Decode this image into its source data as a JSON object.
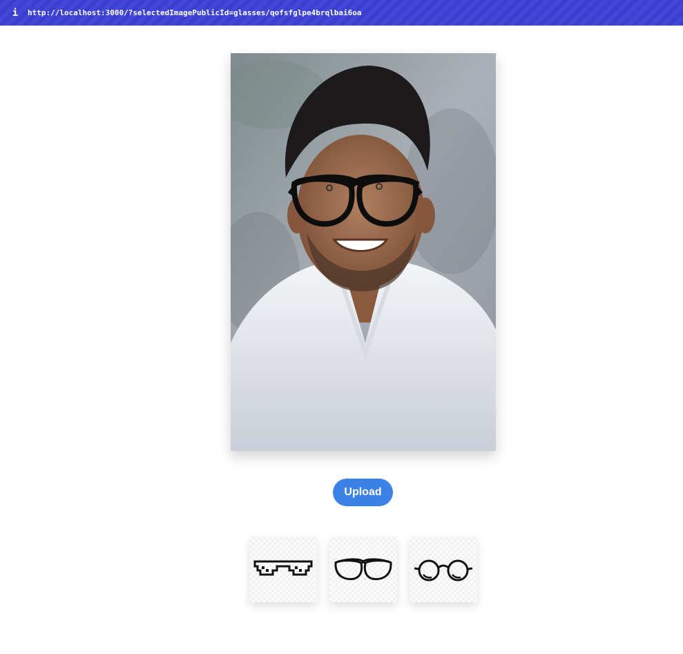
{
  "url_bar": {
    "info_icon": "info-icon",
    "url": "http://localhost:3000/?selectedImagePublicId=glasses/qofsfglpe4brqlbai6oa",
    "background_color": "#3b3fd0"
  },
  "main": {
    "photo": {
      "icon": "portrait-photo-with-glasses-overlay"
    },
    "upload_button": {
      "label": "Upload",
      "color": "#3b82e6"
    },
    "glasses_options": [
      {
        "icon": "pixel-sunglasses-icon"
      },
      {
        "icon": "aviator-glasses-icon"
      },
      {
        "icon": "round-glasses-icon"
      }
    ]
  }
}
